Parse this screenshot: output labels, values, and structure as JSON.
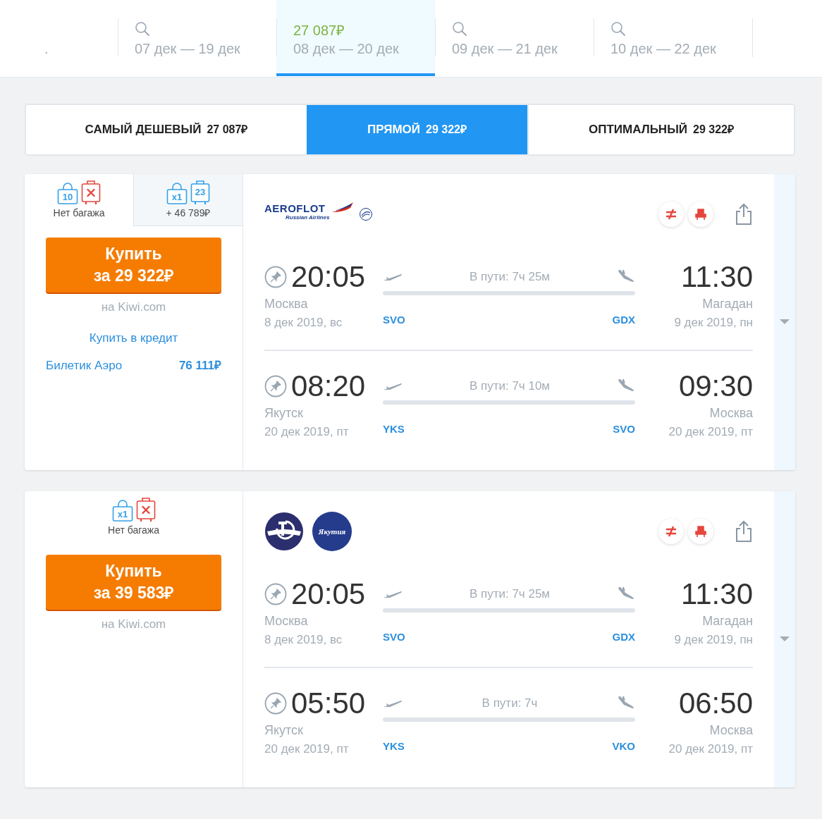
{
  "date_tabs": [
    {
      "kind": "partial",
      "label": ".",
      "selected": false
    },
    {
      "kind": "search",
      "label": "07 дек — 19 дек",
      "selected": false
    },
    {
      "kind": "price",
      "price": "27 087₽",
      "label": "08 дек — 20 дек",
      "selected": true
    },
    {
      "kind": "search",
      "label": "09 дек — 21 дек",
      "selected": false
    },
    {
      "kind": "search",
      "label": "10 дек — 22 дек",
      "selected": false
    }
  ],
  "sort_tabs": [
    {
      "label": "САМЫЙ ДЕШЕВЫЙ",
      "price": "27 087₽",
      "selected": false
    },
    {
      "label": "ПРЯМОЙ",
      "price": "29 322₽",
      "selected": true
    },
    {
      "label": "ОПТИМАЛЬНЫЙ",
      "price": "29 322₽",
      "selected": false
    }
  ],
  "tickets": [
    {
      "baggage_options": [
        {
          "hand": "10",
          "checked": {
            "included": false
          },
          "label": "Нет багажа",
          "selected": true
        },
        {
          "hand": "x1",
          "checked": {
            "included": true,
            "label": "23"
          },
          "label": "+ 46 789₽",
          "selected": false
        }
      ],
      "buy_button": {
        "line1": "Купить",
        "line2": "за 29 322₽"
      },
      "seller": "на Kiwi.com",
      "credit_link": "Купить в кредит",
      "other_offers": [
        {
          "agency": "Билетик Аэро",
          "price": "76 111₽"
        }
      ],
      "airlines": [
        {
          "kind": "aeroflot",
          "name": "AEROFLOT",
          "subtitle": "Russian Airlines"
        }
      ],
      "segments": [
        {
          "dep_time": "20:05",
          "dep_city": "Москва",
          "dep_date": "8 дек 2019, вс",
          "dep_code": "SVO",
          "duration": "В пути: 7ч 25м",
          "arr_code": "GDX",
          "arr_time": "11:30",
          "arr_city": "Магадан",
          "arr_date": "9 дек 2019, пн"
        },
        {
          "dep_time": "08:20",
          "dep_city": "Якутск",
          "dep_date": "20 дек 2019, пт",
          "dep_code": "YKS",
          "duration": "В пути: 7ч 10м",
          "arr_code": "SVO",
          "arr_time": "09:30",
          "arr_city": "Москва",
          "arr_date": "20 дек 2019, пт"
        }
      ]
    },
    {
      "baggage_options": [
        {
          "hand": "x1",
          "checked": {
            "included": false
          },
          "label": "Нет багажа",
          "selected": true
        }
      ],
      "buy_button": {
        "line1": "Купить",
        "line2": "за 39 583₽"
      },
      "seller": "на Kiwi.com",
      "airlines": [
        {
          "kind": "emblem"
        },
        {
          "kind": "yakutia",
          "name": "Якутия"
        }
      ],
      "segments": [
        {
          "dep_time": "20:05",
          "dep_city": "Москва",
          "dep_date": "8 дек 2019, вс",
          "dep_code": "SVO",
          "duration": "В пути: 7ч 25м",
          "arr_code": "GDX",
          "arr_time": "11:30",
          "arr_city": "Магадан",
          "arr_date": "9 дек 2019, пн"
        },
        {
          "dep_time": "05:50",
          "dep_city": "Якутск",
          "dep_date": "20 дек 2019, пт",
          "dep_code": "YKS",
          "duration": "В пути: 7ч",
          "arr_code": "VKO",
          "arr_time": "06:50",
          "arr_city": "Москва",
          "arr_date": "20 дек 2019, пт"
        }
      ]
    }
  ]
}
